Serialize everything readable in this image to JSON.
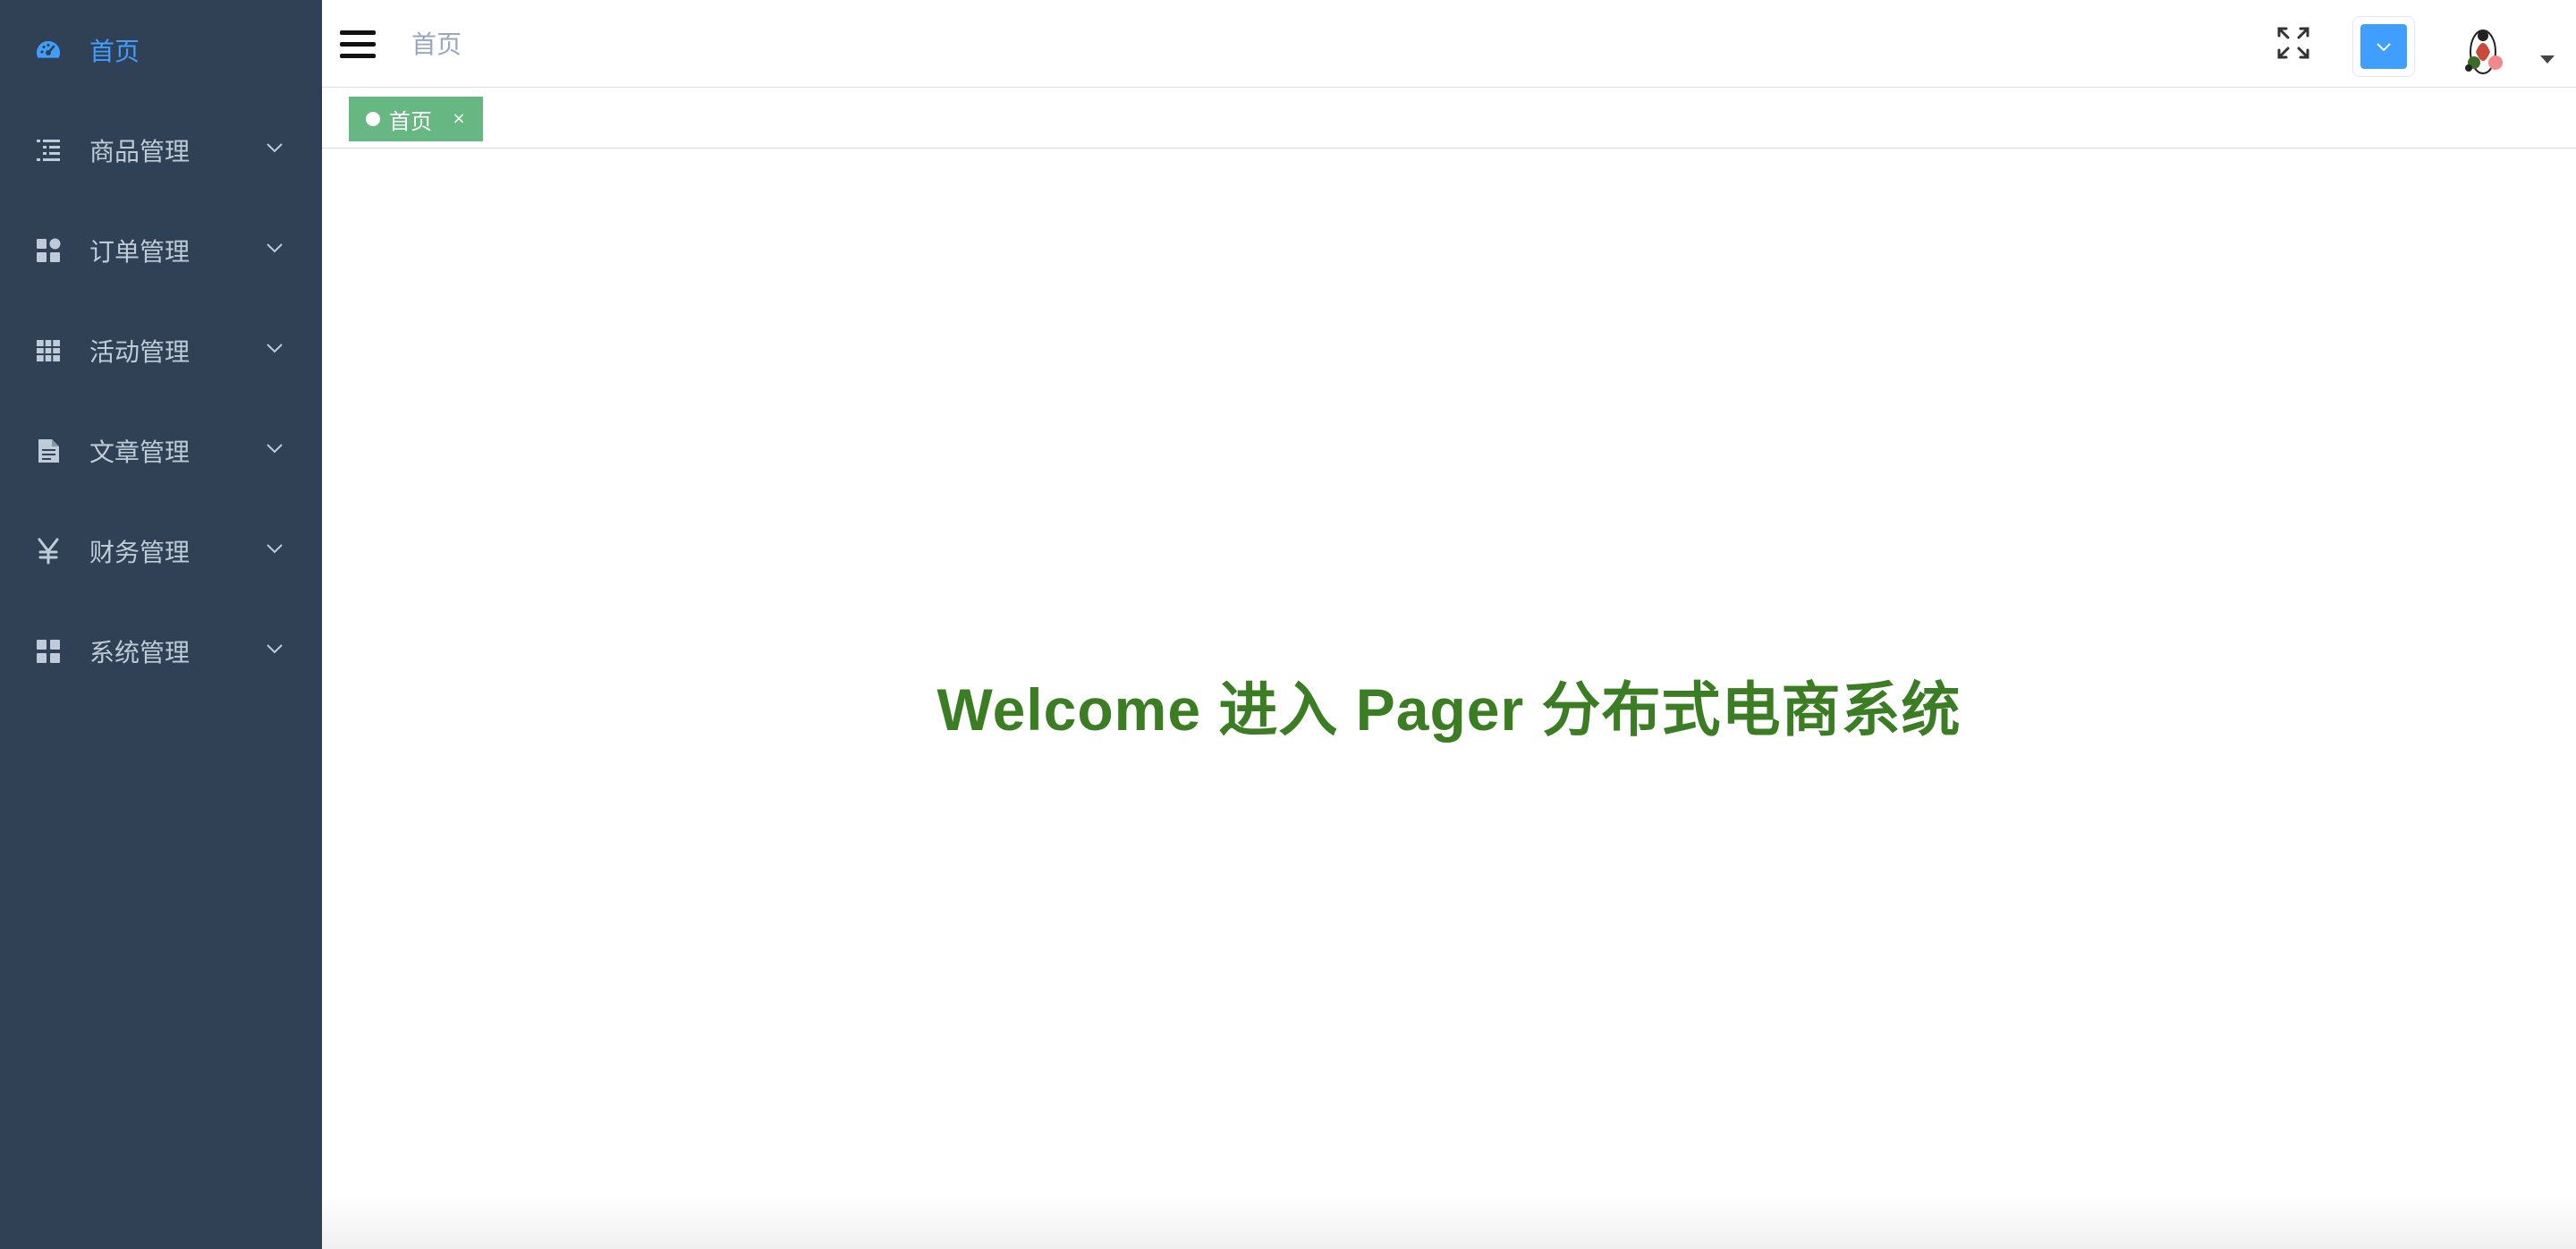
{
  "sidebar": {
    "background": "#304156",
    "active_color": "#409eff",
    "items": [
      {
        "label": "首页",
        "icon": "dashboard-icon",
        "active": true,
        "has_submenu": false
      },
      {
        "label": "商品管理",
        "icon": "list-icon",
        "active": false,
        "has_submenu": true
      },
      {
        "label": "订单管理",
        "icon": "grid-icon",
        "active": false,
        "has_submenu": true
      },
      {
        "label": "活动管理",
        "icon": "table-icon",
        "active": false,
        "has_submenu": true
      },
      {
        "label": "文章管理",
        "icon": "document-icon",
        "active": false,
        "has_submenu": true
      },
      {
        "label": "财务管理",
        "icon": "yen-icon",
        "active": false,
        "has_submenu": true
      },
      {
        "label": "系统管理",
        "icon": "grid-icon",
        "active": false,
        "has_submenu": true
      }
    ]
  },
  "navbar": {
    "breadcrumb": "首页",
    "theme_color": "#409eff"
  },
  "tags_view": {
    "tags": [
      {
        "label": "首页",
        "close": "×",
        "active": true,
        "color": "#67b783"
      }
    ]
  },
  "content": {
    "welcome": "Welcome 进入 Pager 分布式电商系统",
    "welcome_color": "#3a7d22"
  }
}
